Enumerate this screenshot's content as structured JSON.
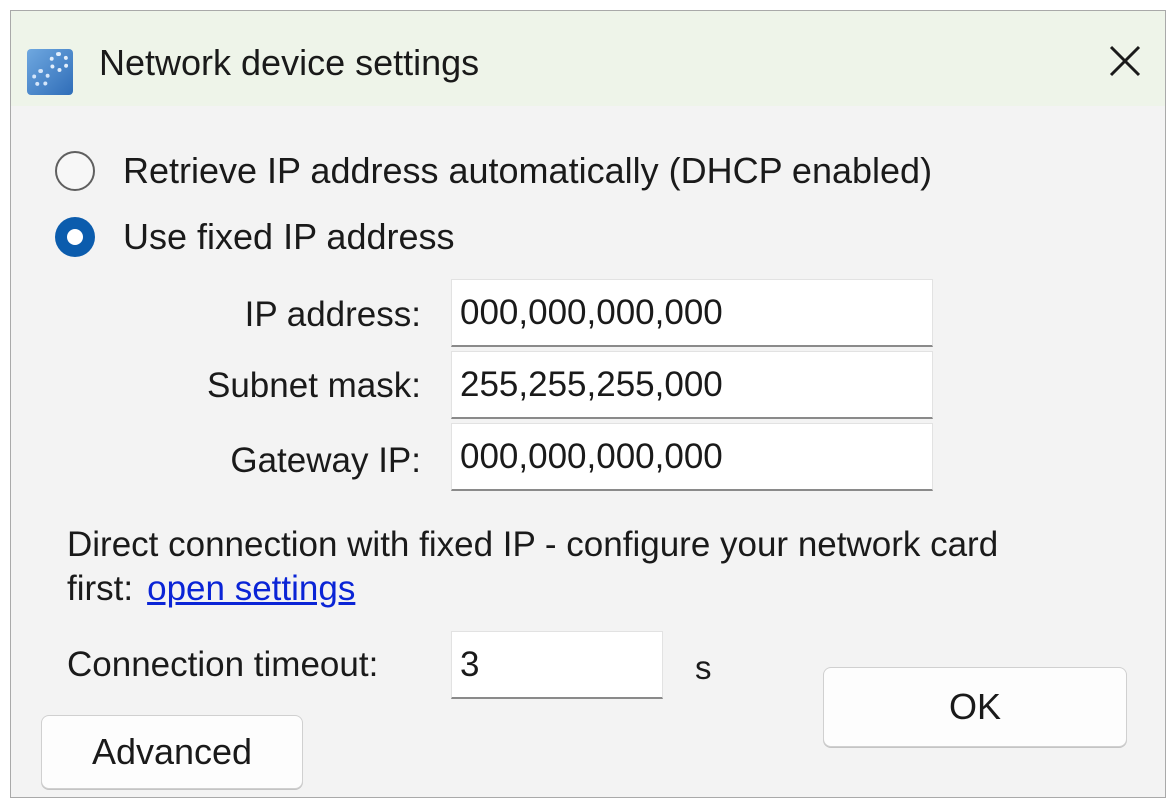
{
  "window": {
    "title": "Network device settings",
    "app_icon": "network-settings-gears-icon",
    "close_icon": "close-icon"
  },
  "ip_mode": {
    "options": [
      {
        "label": "Retrieve IP address automatically (DHCP enabled)",
        "selected": false
      },
      {
        "label": "Use fixed IP address",
        "selected": true
      }
    ]
  },
  "fields": {
    "ip_address": {
      "label": "IP address:",
      "value": "000,000,000,000"
    },
    "subnet_mask": {
      "label": "Subnet mask:",
      "value": "255,255,255,000"
    },
    "gateway_ip": {
      "label": "Gateway IP:",
      "value": "000,000,000,000"
    }
  },
  "info": {
    "text": "Direct connection with fixed IP - configure your network card first:",
    "link_label": "open settings"
  },
  "timeout": {
    "label": "Connection timeout:",
    "value": "3",
    "unit": "s"
  },
  "buttons": {
    "ok_label": "OK",
    "advanced_label": "Advanced"
  },
  "colors": {
    "accent": "#0b5cad",
    "link": "#0a24d6",
    "titlebar": "#eef4e9",
    "dialog_bg": "#f3f3f3"
  }
}
